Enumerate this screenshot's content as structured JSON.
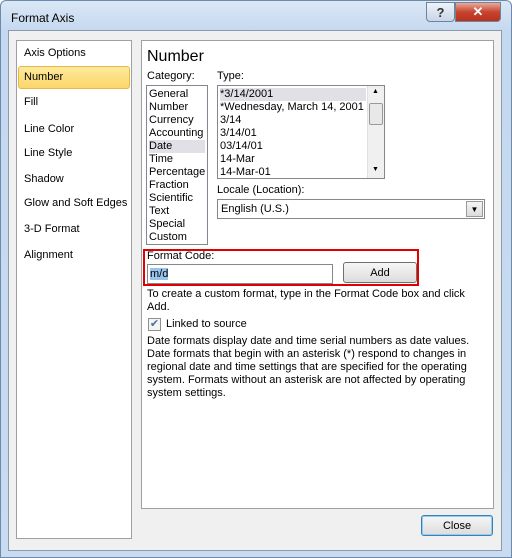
{
  "window": {
    "title": "Format Axis",
    "help_label": "?",
    "close_label": "✕"
  },
  "sidebar": {
    "items": [
      {
        "label": "Axis Options"
      },
      {
        "label": "Number",
        "selected": true
      },
      {
        "label": "Fill"
      },
      {
        "label": "Line Color"
      },
      {
        "label": "Line Style"
      },
      {
        "label": "Shadow"
      },
      {
        "label": "Glow and Soft Edges"
      },
      {
        "label": "3-D Format"
      },
      {
        "label": "Alignment"
      }
    ]
  },
  "main": {
    "heading": "Number",
    "category_label": "Category:",
    "categories": [
      "General",
      "Number",
      "Currency",
      "Accounting",
      "Date",
      "Time",
      "Percentage",
      "Fraction",
      "Scientific",
      "Text",
      "Special",
      "Custom"
    ],
    "selected_category": "Date",
    "type_label": "Type:",
    "types": [
      "*3/14/2001",
      "*Wednesday, March 14, 2001",
      "3/14",
      "3/14/01",
      "03/14/01",
      "14-Mar",
      "14-Mar-01"
    ],
    "selected_type": "*3/14/2001",
    "locale_label": "Locale (Location):",
    "locale_value": "English (U.S.)",
    "format_code_label": "Format Code:",
    "format_code_value": "m/d",
    "add_label": "Add",
    "help_lines": [
      "To create a custom format, type in the Format Code box and click",
      "Add."
    ],
    "linked_label": "Linked to source",
    "linked_checked": true,
    "description_lines": [
      "Date formats display date and time serial numbers as date values.",
      "Date formats that begin with an asterisk (*) respond to changes in",
      "regional date and time settings that are specified for the operating",
      "system. Formats without an asterisk are not affected by operating",
      "system settings."
    ],
    "highlight_color": "#e00000"
  },
  "footer": {
    "close_label": "Close"
  }
}
